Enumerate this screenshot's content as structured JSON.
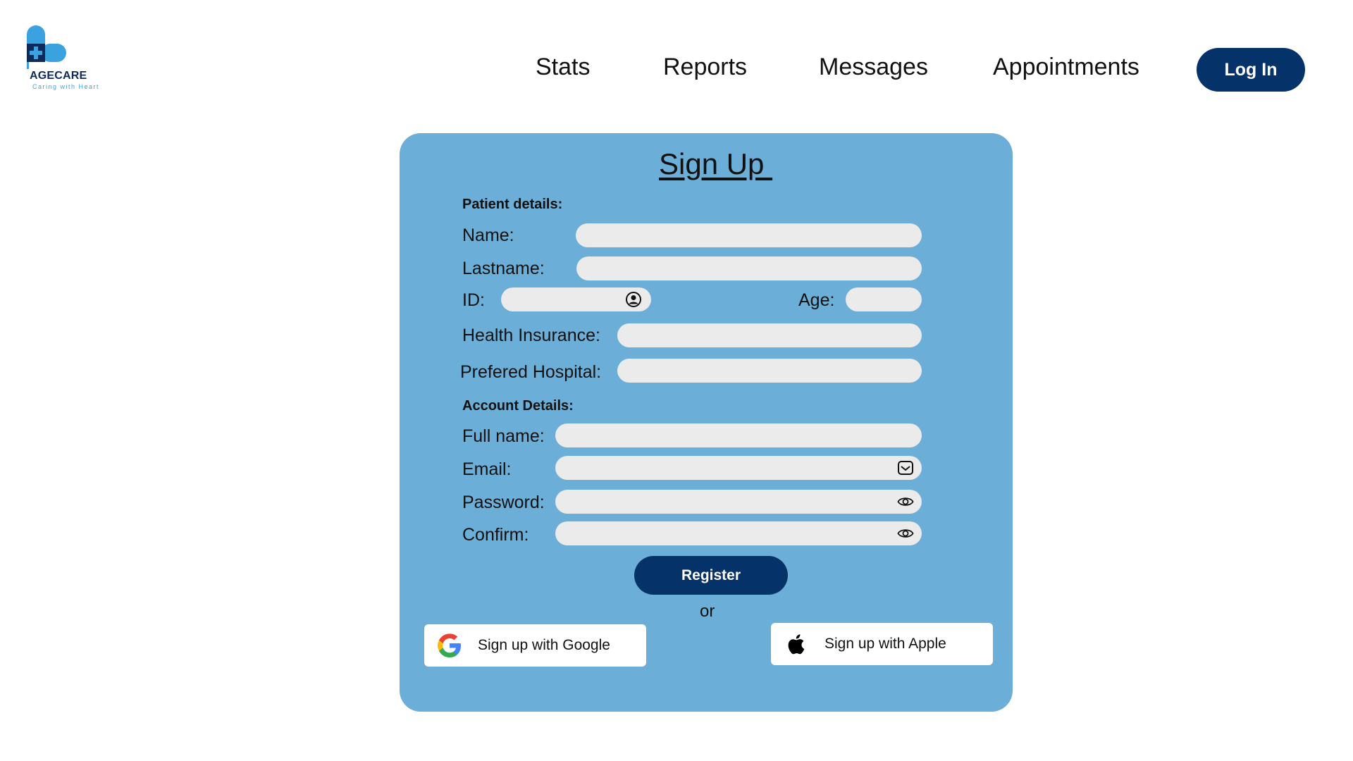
{
  "brand": {
    "name": "AGECARE",
    "tagline": "Caring with Heart",
    "colors": {
      "navy": "#06326a",
      "light_blue": "#3aa3df",
      "card": "#6baed7",
      "field": "#ebebeb"
    }
  },
  "nav": {
    "items": [
      "Stats",
      "Reports",
      "Messages",
      "Appointments"
    ],
    "login_label": "Log In"
  },
  "form": {
    "title": "Sign Up ",
    "patient_section": "Patient details:",
    "account_section": "Account Details:",
    "labels": {
      "name": "Name:",
      "lastname": "Lastname:",
      "id": "ID:",
      "age": "Age:",
      "health_insurance": "Health Insurance:",
      "preferred_hospital": "Prefered Hospital:",
      "full_name": "Full name:",
      "email": "Email:",
      "password": "Password:",
      "confirm": "Confirm:"
    },
    "values": {
      "name": "",
      "lastname": "",
      "id": "",
      "age": "",
      "health_insurance": "",
      "preferred_hospital": "",
      "full_name": "",
      "email": "",
      "password": "",
      "confirm": ""
    },
    "register_label": "Register",
    "or_label": "or",
    "google_label": "Sign up with Google",
    "apple_label": "Sign up with Apple",
    "icons": {
      "id": "user-circle-icon",
      "email": "mail-icon",
      "password": "eye-icon",
      "confirm": "eye-icon",
      "google": "google-icon",
      "apple": "apple-icon"
    }
  }
}
